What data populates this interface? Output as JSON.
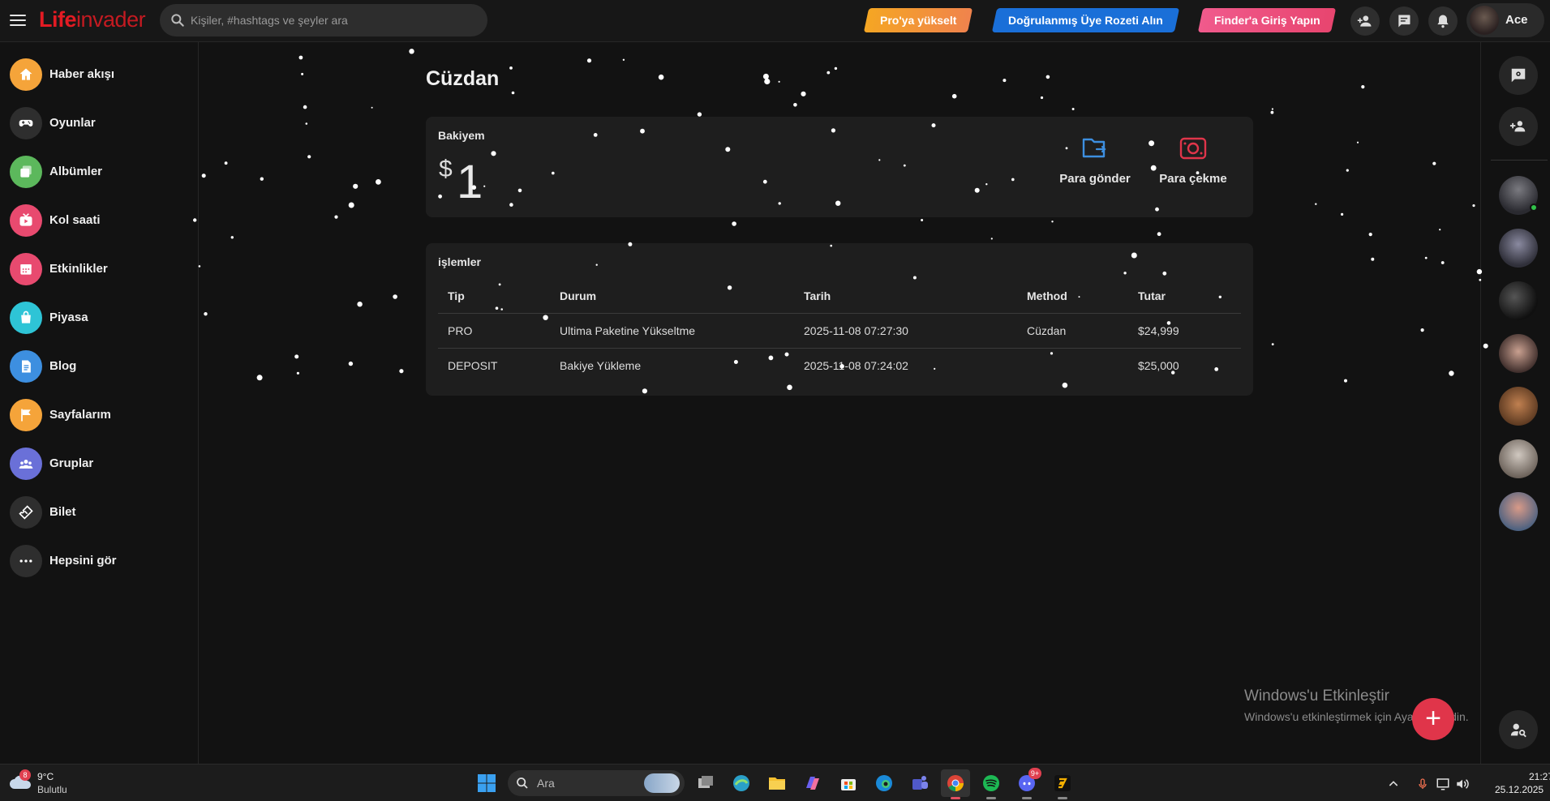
{
  "topbar": {
    "logo_part1": "Life",
    "logo_part2": "invader",
    "search_placeholder": "Kişiler, #hashtags ve şeyler ara",
    "pro_upgrade": "Pro'ya yükselt",
    "verified_badge": "Doğrulanmış Üye Rozeti Alın",
    "finder_login": "Finder'a Giriş Yapın",
    "username": "Ace"
  },
  "sidebar": {
    "items": [
      {
        "label": "Haber akışı",
        "icon": "home-icon",
        "color": "#f5a43a"
      },
      {
        "label": "Oyunlar",
        "icon": "gamepad-icon",
        "color": "#2e2e2e"
      },
      {
        "label": "Albümler",
        "icon": "albums-icon",
        "color": "#5cb85c"
      },
      {
        "label": "Kol saati",
        "icon": "watch-icon",
        "color": "#e84a6f"
      },
      {
        "label": "Etkinlikler",
        "icon": "calendar-icon",
        "color": "#e84a6f"
      },
      {
        "label": "Piyasa",
        "icon": "market-icon",
        "color": "#2ec4d6"
      },
      {
        "label": "Blog",
        "icon": "blog-icon",
        "color": "#3d8fe0"
      },
      {
        "label": "Sayfalarım",
        "icon": "flag-icon",
        "color": "#f5a43a"
      },
      {
        "label": "Gruplar",
        "icon": "groups-icon",
        "color": "#6a70d8"
      },
      {
        "label": "Bilet",
        "icon": "ticket-icon",
        "color": "#2e2e2e"
      },
      {
        "label": "Hepsini gör",
        "icon": "more-icon",
        "color": "#2e2e2e"
      }
    ]
  },
  "wallet": {
    "title": "Cüzdan",
    "balance_label": "Bakiyem",
    "currency": "$",
    "balance": "1",
    "send_label": "Para gönder",
    "withdraw_label": "Para çekme",
    "send_color": "#3d8fe0",
    "withdraw_color": "#e0354a"
  },
  "transactions": {
    "title": "işlemler",
    "columns": [
      "Tip",
      "Durum",
      "Tarih",
      "Method",
      "Tutar"
    ],
    "rows": [
      {
        "tip": "PRO",
        "durum": "Ultima Paketine Yükseltme",
        "tarih": "2025-11-08 07:27:30",
        "method": "Cüzdan",
        "tutar": "$24,999"
      },
      {
        "tip": "DEPOSIT",
        "durum": "Bakiye Yükleme",
        "tarih": "2025-11-08 07:24:02",
        "method": "",
        "tutar": "$25,000"
      }
    ]
  },
  "watermark": {
    "title": "Windows'u Etkinleştir",
    "subtitle": "Windows'u etkinleştirmek için Ayarlar'a gidin."
  },
  "taskbar": {
    "weather_temp": "9°C",
    "weather_desc": "Bulutlu",
    "weather_badge": "8",
    "search_label": "Ara",
    "time": "21:27",
    "date": "25.12.2025",
    "discord_badge": "9+"
  }
}
